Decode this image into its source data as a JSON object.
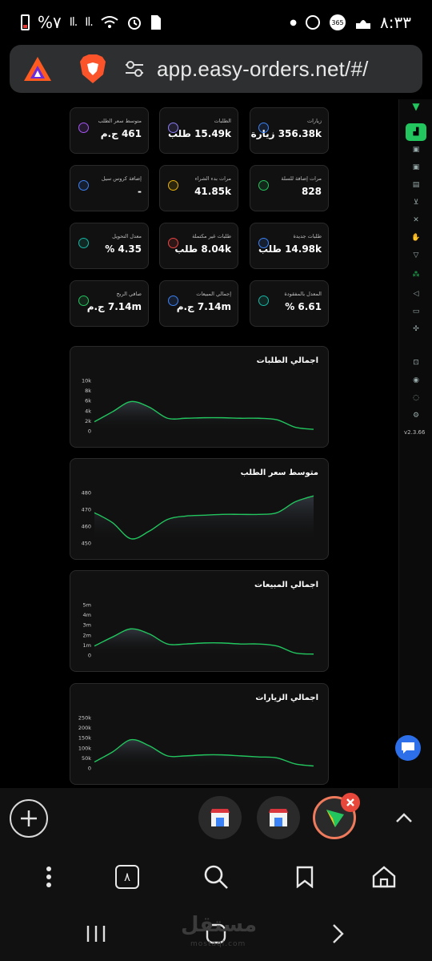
{
  "status": {
    "time": "٨:٣٣",
    "battery": "%٧",
    "icons": [
      "battery-icon",
      "signal-icon",
      "signal-icon",
      "wifi-icon",
      "alarm-icon",
      "sim-icon",
      "whatsapp-icon",
      "365-icon",
      "mosque-icon"
    ]
  },
  "browser": {
    "url": "app.easy-orders.net/#/",
    "tab_count": "٨"
  },
  "stats": [
    {
      "label": "متوسط سعر الطلب",
      "value": "461 ج.م",
      "color": "#a855f7"
    },
    {
      "label": "الطلبات",
      "value": "15.49k طلب",
      "color": "#8b7cf6"
    },
    {
      "label": "زيارات",
      "value": "356.38k زيارة",
      "color": "#3b82f6"
    },
    {
      "label": "إضافة كروس سيل",
      "value": "-",
      "color": "#3b82f6"
    },
    {
      "label": "مرات بدء الشراء",
      "value": "41.85k",
      "color": "#eab308"
    },
    {
      "label": "مرات إضافة للسلة",
      "value": "828",
      "color": "#22c55e"
    },
    {
      "label": "معدل التحويل",
      "value": "4.35 %",
      "color": "#14b8a6"
    },
    {
      "label": "طلبات غير مكتملة",
      "value": "8.04k طلب",
      "color": "#ef4444"
    },
    {
      "label": "طلبات جديدة",
      "value": "14.98k طلب",
      "color": "#3b82f6"
    },
    {
      "label": "صافي الربح",
      "value": "7.14m ج.م",
      "color": "#22c55e"
    },
    {
      "label": "إجمالي المبيعات",
      "value": "7.14m ج.م",
      "color": "#3b82f6"
    },
    {
      "label": "المعدل بالمفقودة",
      "value": "6.61 %",
      "color": "#14b8a6"
    }
  ],
  "chart_data": [
    {
      "type": "area",
      "title": "اجمالي الطلبات",
      "yticks": [
        "10k",
        "8k",
        "6k",
        "4k",
        "2k",
        "0"
      ],
      "ylim": [
        0,
        10000
      ],
      "x": [
        0,
        1,
        2,
        3,
        4,
        5,
        6,
        7,
        8,
        9,
        10,
        11,
        12
      ],
      "values": [
        1800,
        3800,
        5800,
        4700,
        2500,
        2500,
        2600,
        2600,
        2500,
        2500,
        2200,
        700,
        300
      ],
      "color": "#22c55e",
      "grid": false
    },
    {
      "type": "area",
      "title": "متوسط سعر الطلب",
      "yticks": [
        "480",
        "470",
        "460",
        "450"
      ],
      "ylim": [
        450,
        480
      ],
      "x": [
        0,
        1,
        2,
        3,
        4,
        5,
        6,
        7,
        8,
        9,
        10,
        11,
        12
      ],
      "values": [
        468,
        462,
        452.5,
        457,
        464,
        466,
        466.5,
        467,
        467,
        467,
        468,
        474.5,
        478
      ],
      "color": "#22c55e",
      "grid": false
    },
    {
      "type": "area",
      "title": "اجمالي المبيعات",
      "yticks": [
        "5m",
        "4m",
        "3m",
        "2m",
        "1m",
        "0"
      ],
      "ylim": [
        0,
        5000000
      ],
      "x": [
        0,
        1,
        2,
        3,
        4,
        5,
        6,
        7,
        8,
        9,
        10,
        11,
        12
      ],
      "values": [
        900000,
        1800000,
        2600000,
        2100000,
        1100000,
        1100000,
        1200000,
        1200000,
        1100000,
        1100000,
        900000,
        200000,
        100000
      ],
      "color": "#22c55e",
      "grid": false
    },
    {
      "type": "area",
      "title": "اجمالي الزيارات",
      "yticks": [
        "250k",
        "200k",
        "150k",
        "100k",
        "50k",
        "0"
      ],
      "ylim": [
        0,
        250000
      ],
      "x": [
        0,
        1,
        2,
        3,
        4,
        5,
        6,
        7,
        8,
        9,
        10,
        11,
        12
      ],
      "values": [
        30000,
        80000,
        140000,
        110000,
        60000,
        60000,
        65000,
        65000,
        60000,
        55000,
        50000,
        20000,
        10000
      ],
      "color": "#22c55e",
      "grid": false
    }
  ],
  "watermark": {
    "ar": "مستقل",
    "en": "mostaql.com"
  }
}
